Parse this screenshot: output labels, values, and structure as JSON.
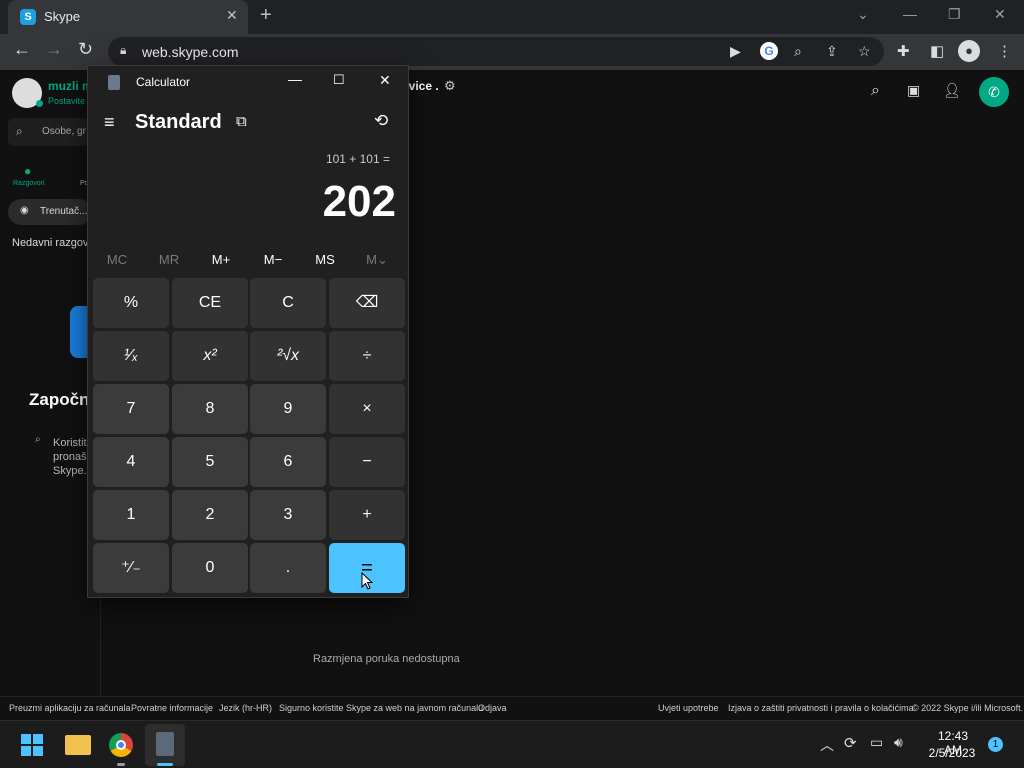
{
  "browser": {
    "tab_title": "Skype",
    "tab_favicon_letter": "S",
    "url": "web.skype.com"
  },
  "skype": {
    "profile_name": "muzli m",
    "profile_status": "Postavite s",
    "search_placeholder": "Osobe, gr",
    "nav_chats": "Razgovori",
    "nav_calls": "Po",
    "meet_now": "Trenutač...",
    "recent_chats": "Nedavni razgov",
    "start_title": "Započni",
    "hint_line1": "Koristit",
    "hint_line2": "pronaš",
    "hint_line3": "Skype.",
    "header_title": "rvice .",
    "empty_message": "Razmjena poruka nedostupna",
    "footer_left": [
      "Preuzmi aplikaciju za računala",
      "Povratne informacije",
      "Jezik (hr-HR)",
      "Sigurno koristite Skype za web na javnom računalu",
      "Odjava"
    ],
    "footer_right": [
      "Uvjeti upotrebe",
      "Izjava o zaštiti privatnosti i pravila o kolačićima",
      "© 2022 Skype i/ili Microsoft."
    ]
  },
  "calculator": {
    "window_title": "Calculator",
    "mode": "Standard",
    "expression": "101 + 101 =",
    "display": "202",
    "memory": [
      "MC",
      "MR",
      "M+",
      "M−",
      "MS",
      "M⌄"
    ],
    "buttons": [
      [
        "%",
        "CE",
        "C",
        "⌫"
      ],
      [
        "¹⁄ₓ",
        "x²",
        "²√x",
        "÷"
      ],
      [
        "7",
        "8",
        "9",
        "×"
      ],
      [
        "4",
        "5",
        "6",
        "−"
      ],
      [
        "1",
        "2",
        "3",
        "+"
      ],
      [
        "⁺⁄₋",
        "0",
        ".",
        "="
      ]
    ]
  },
  "taskbar": {
    "time": "12:43 AM",
    "date": "2/5/2023",
    "notification_count": "1"
  },
  "colors": {
    "accent": "#4cc2ff",
    "skype_green": "#00a884",
    "taskbar": "#1c1c1c"
  }
}
